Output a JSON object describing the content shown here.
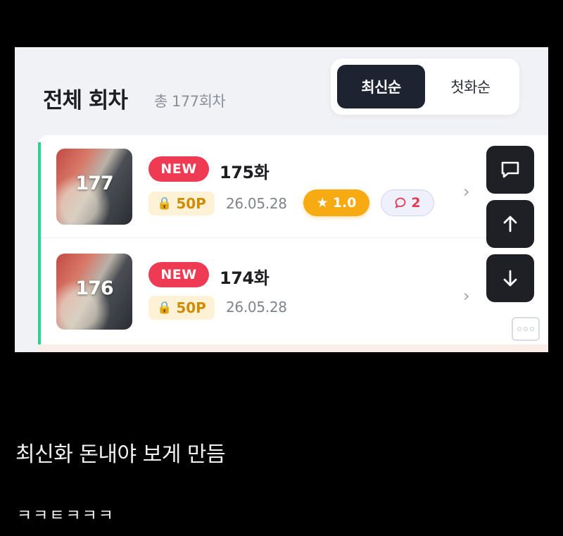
{
  "section": {
    "title": "전체 회차",
    "count": "총 177회차"
  },
  "sort": {
    "latest": "최신순",
    "first": "첫화순"
  },
  "episodes": [
    {
      "thumb_num": "177",
      "badge": "NEW",
      "title": "175화",
      "price": "50P",
      "date": "26.05.28",
      "rating": "1.0",
      "comments": "2"
    },
    {
      "thumb_num": "176",
      "badge": "NEW",
      "title": "174화",
      "price": "50P",
      "date": "26.05.28"
    }
  ],
  "icons": {
    "lock": "lock-icon",
    "star": "star-icon",
    "comment": "comment-icon",
    "chevron": "chevron-right-icon",
    "chat": "chat-bubble-icon",
    "up": "arrow-up-icon",
    "down": "arrow-down-icon"
  },
  "colors": {
    "new_badge": "#ef3a53",
    "rating": "#f7aa12",
    "accent_bar": "#2fcf91",
    "price_text": "#d38c00"
  },
  "captions": {
    "line1": "최신화 돈내야 보게 만듬",
    "line2": "ㅋㅋㅌㅋㅋㅋ"
  }
}
